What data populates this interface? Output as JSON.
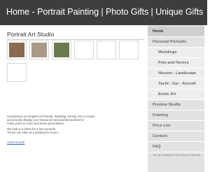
{
  "site": {
    "title": "Home - Portrait Painting | Photo Gifts | Unique Gifts"
  },
  "main": {
    "page_title": "Portrait Art Studio",
    "thumbnails": [
      {
        "label": "Portrait photo 1",
        "color": "#8a6a50"
      },
      {
        "label": "Portrait photo 2",
        "color": "#a89a86"
      },
      {
        "label": "Portrait photo 3",
        "color": "#6b7a4e"
      },
      {
        "label": "Empty slot 4",
        "color": "#ffffff"
      },
      {
        "label": "Empty slot 5",
        "color": "#ffffff"
      },
      {
        "label": "Empty slot 6",
        "color": "#ffffff"
      },
      {
        "label": "Empty slot 7",
        "color": "#ffffff"
      }
    ],
    "intro": [
      "Commission an Original Oil Portrait, Wedding, Family, Pet or House",
      "and proudly display your treasured hand painted portrait for",
      "many years to come and future generations."
    ],
    "intro2": [
      "We built at a photo for a few seconds.",
      "Yet we can stare at a painting for hours..."
    ],
    "artist_link": "Artist at work"
  },
  "sidebar": {
    "items": [
      {
        "label": "Home",
        "sub": false,
        "active": true
      },
      {
        "label": "Personal Portraits",
        "sub": false,
        "active": false
      },
      {
        "label": "Weddings",
        "sub": true,
        "active": false
      },
      {
        "label": "Pets and Horses",
        "sub": true,
        "active": false
      },
      {
        "label": "Houses - Landscape",
        "sub": true,
        "active": false
      },
      {
        "label": "Yacht - Car - Aircraft",
        "sub": true,
        "active": false
      },
      {
        "label": "Erotic Art",
        "sub": true,
        "active": false
      },
      {
        "label": "Preview Studio",
        "sub": false,
        "active": false
      },
      {
        "label": "Framing",
        "sub": false,
        "active": false
      },
      {
        "label": "Price List",
        "sub": false,
        "active": false
      },
      {
        "label": "Content",
        "sub": false,
        "active": false
      },
      {
        "label": "FAQ",
        "sub": false,
        "active": false
      }
    ],
    "note": "You are viewing the text version of this site."
  }
}
